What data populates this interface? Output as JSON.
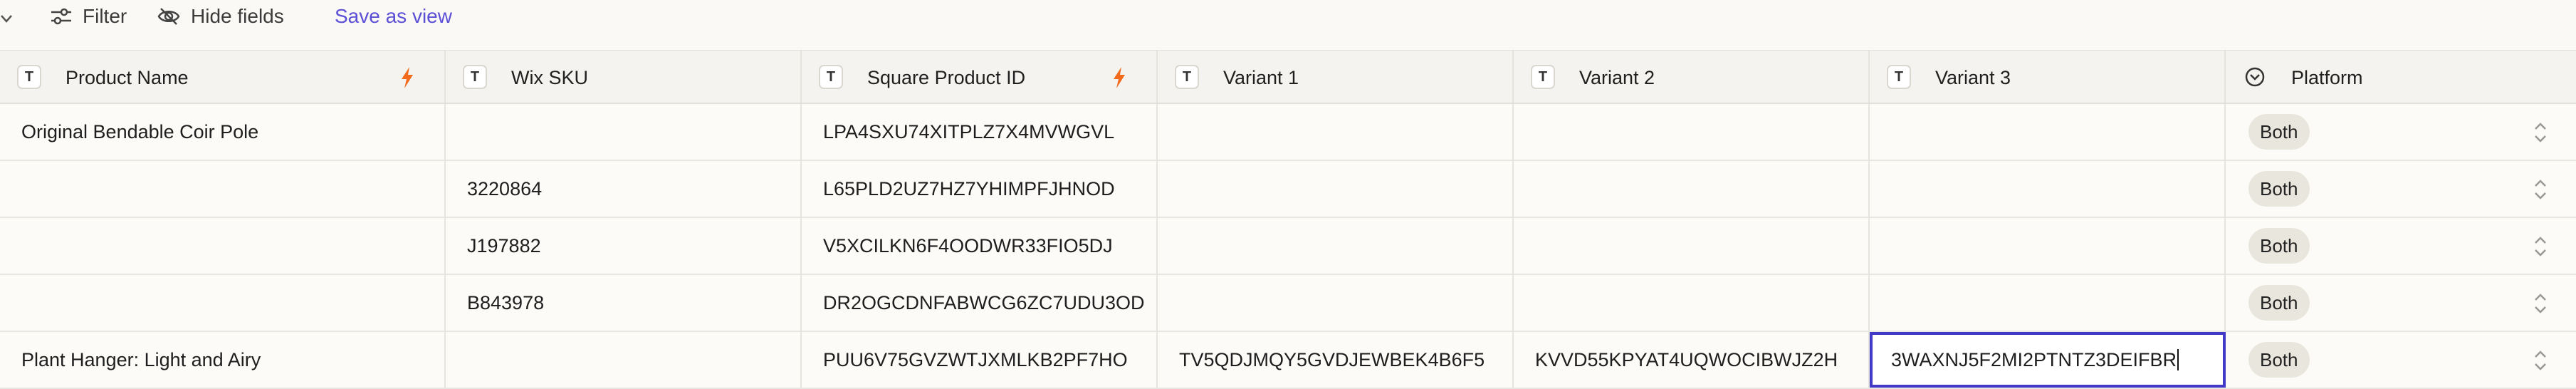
{
  "toolbar": {
    "filter_label": "Filter",
    "hide_fields_label": "Hide fields",
    "save_view_label": "Save as view"
  },
  "columns": [
    {
      "label": "Product Name",
      "type_icon": "T",
      "has_bolt": true
    },
    {
      "label": "Wix SKU",
      "type_icon": "T",
      "has_bolt": false
    },
    {
      "label": "Square Product ID",
      "type_icon": "T",
      "has_bolt": true
    },
    {
      "label": "Variant 1",
      "type_icon": "T",
      "has_bolt": false
    },
    {
      "label": "Variant 2",
      "type_icon": "T",
      "has_bolt": false
    },
    {
      "label": "Variant 3",
      "type_icon": "T",
      "has_bolt": false
    },
    {
      "label": "Platform",
      "type_icon": "select-circle-icon",
      "has_bolt": false
    }
  ],
  "rows": [
    {
      "product_name": "Original Bendable Coir Pole",
      "wix_sku": "",
      "square_id": "LPA4SXU74XITPLZ7X4MVWGVL",
      "variant1": "",
      "variant2": "",
      "variant3": "",
      "platform": "Both"
    },
    {
      "product_name": "",
      "wix_sku": "3220864",
      "square_id": "L65PLD2UZ7HZ7YHIMPFJHNOD",
      "variant1": "",
      "variant2": "",
      "variant3": "",
      "platform": "Both"
    },
    {
      "product_name": "",
      "wix_sku": "J197882",
      "square_id": "V5XCILKN6F4OODWR33FIO5DJ",
      "variant1": "",
      "variant2": "",
      "variant3": "",
      "platform": "Both"
    },
    {
      "product_name": "",
      "wix_sku": "B843978",
      "square_id": "DR2OGCDNFABWCG6ZC7UDU3OD",
      "variant1": "",
      "variant2": "",
      "variant3": "",
      "platform": "Both"
    },
    {
      "product_name": "Plant Hanger: Light and Airy",
      "wix_sku": "",
      "square_id": "PUU6V75GVZWTJXMLKB2PF7HO",
      "variant1": "TV5QDJMQY5GVDJEWBEK4B6F5",
      "variant2": "KVVD55KPYAT4UQWOCIBWJZ2H",
      "variant3": "3WAXNJ5F2MI2PTNTZ3DEIFBR",
      "platform": "Both"
    }
  ],
  "colors": {
    "accent": "#5b4fd6",
    "edit_outline": "#4339c9",
    "bolt": "#f26a1b",
    "badge_bg": "#e9e6de"
  }
}
